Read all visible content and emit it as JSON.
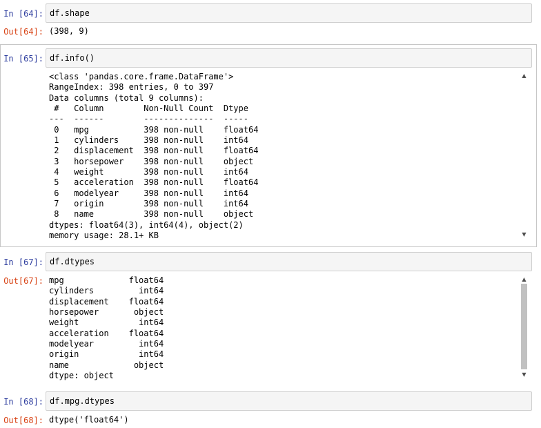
{
  "cells": [
    {
      "in_prompt": "In [64]:",
      "code": "df.shape",
      "out_prompt": "Out[64]:",
      "output": "(398, 9)"
    },
    {
      "in_prompt": "In [65]:",
      "code": "df.info()",
      "output": "<class 'pandas.core.frame.DataFrame'>\nRangeIndex: 398 entries, 0 to 397\nData columns (total 9 columns):\n #   Column        Non-Null Count  Dtype  \n---  ------        --------------  -----  \n 0   mpg           398 non-null    float64\n 1   cylinders     398 non-null    int64  \n 2   displacement  398 non-null    float64\n 3   horsepower    398 non-null    object \n 4   weight        398 non-null    int64  \n 5   acceleration  398 non-null    float64\n 6   modelyear     398 non-null    int64  \n 7   origin        398 non-null    int64  \n 8   name          398 non-null    object \ndtypes: float64(3), int64(4), object(2)\nmemory usage: 28.1+ KB"
    },
    {
      "in_prompt": "In [67]:",
      "code": "df.dtypes",
      "out_prompt": "Out[67]:",
      "output": "mpg             float64\ncylinders         int64\ndisplacement    float64\nhorsepower       object\nweight            int64\nacceleration    float64\nmodelyear         int64\norigin            int64\nname             object\ndtype: object"
    },
    {
      "in_prompt": "In [68]:",
      "code": "df.mpg.dtypes",
      "out_prompt": "Out[68]:",
      "output": "dtype('float64')"
    }
  ],
  "icons": {
    "scroll_up": "▲",
    "scroll_down": "▼"
  },
  "colors": {
    "in_prompt": "#303f9f",
    "out_prompt": "#d84315",
    "input_bg": "#f5f5f5"
  }
}
